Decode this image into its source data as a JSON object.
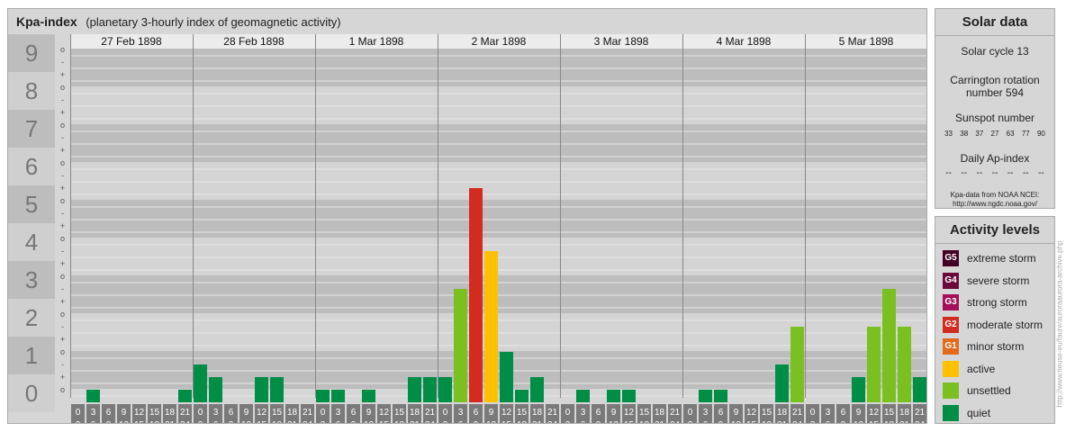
{
  "header": {
    "title": "Kpa-index",
    "subtitle": "(planetary 3-hourly index of geomagnetic activity)"
  },
  "chart_data": {
    "type": "bar",
    "title": "Kpa-index",
    "subtitle": "(planetary 3-hourly index of geomagnetic activity)",
    "y_labels": [
      "9",
      "8",
      "7",
      "6",
      "5",
      "4",
      "3",
      "2",
      "1",
      "0"
    ],
    "minor_labels": [
      "o",
      "-",
      "+",
      "o",
      "-",
      "+",
      "o",
      "-",
      "+",
      "o",
      "-",
      "+",
      "o",
      "-",
      "+",
      "o",
      "-",
      "+",
      "o",
      "-",
      "+",
      "o",
      "-",
      "+",
      "o",
      "-",
      "+",
      "o"
    ],
    "ylim": [
      0,
      9
    ],
    "days": [
      "27 Feb 1898",
      "28 Feb 1898",
      "1 Mar 1898",
      "2 Mar 1898",
      "3 Mar 1898",
      "4 Mar 1898",
      "5 Mar 1898"
    ],
    "interval_start": [
      "0",
      "3",
      "6",
      "9",
      "12",
      "15",
      "18",
      "21"
    ],
    "interval_end": [
      "3",
      "6",
      "9",
      "12",
      "15",
      "18",
      "21",
      "24"
    ],
    "values": [
      [
        0.0,
        0.333,
        0.0,
        0.0,
        0.0,
        0.0,
        0.0,
        0.333
      ],
      [
        1.0,
        0.667,
        0.0,
        0.0,
        0.667,
        0.667,
        0.0,
        0.0
      ],
      [
        0.333,
        0.333,
        0.0,
        0.333,
        0.0,
        0.0,
        0.667,
        0.667
      ],
      [
        0.667,
        3.0,
        5.667,
        4.0,
        1.333,
        0.333,
        0.667,
        0.0
      ],
      [
        0.0,
        0.333,
        0.0,
        0.333,
        0.333,
        0.0,
        0.0,
        0.0
      ],
      [
        0.0,
        0.333,
        0.333,
        0.0,
        0.0,
        0.0,
        1.0,
        2.0
      ],
      [
        0.0,
        0.0,
        0.0,
        0.667,
        2.0,
        3.0,
        2.0,
        0.667
      ]
    ],
    "level_colors": {
      "quiet": "#008d46",
      "unsettled": "#7ac021",
      "active": "#ffc000",
      "minor_storm": "#e26a1c",
      "moderate_storm": "#d42b20",
      "strong_storm": "#a30f59",
      "severe_storm": "#6a0a3c",
      "extreme_storm": "#420024"
    }
  },
  "solar": {
    "title": "Solar data",
    "cycle": "Solar cycle 13",
    "carrington_line1": "Carrington rotation",
    "carrington_line2": "number 594",
    "sunspot_title": "Sunspot number",
    "sunspots": [
      "33",
      "38",
      "37",
      "27",
      "63",
      "77",
      "90"
    ],
    "ap_title": "Daily Ap-index",
    "ap_values": [
      "--",
      "--",
      "--",
      "--",
      "--",
      "--",
      "--"
    ],
    "source_line1": "Kpa-data from NOAA NCEI:",
    "source_line2": "http://www.ngdc.noaa.gov/"
  },
  "legend": {
    "title": "Activity levels",
    "items": [
      {
        "code": "G5",
        "label": "extreme storm",
        "color": "#420024"
      },
      {
        "code": "G4",
        "label": "severe storm",
        "color": "#6a0a3c"
      },
      {
        "code": "G3",
        "label": "strong storm",
        "color": "#a30f59"
      },
      {
        "code": "G2",
        "label": "moderate storm",
        "color": "#d42b20"
      },
      {
        "code": "G1",
        "label": "minor storm",
        "color": "#e26a1c"
      },
      {
        "code": "",
        "label": "active",
        "color": "#ffc000"
      },
      {
        "code": "",
        "label": "unsettled",
        "color": "#7ac021"
      },
      {
        "code": "",
        "label": "quiet",
        "color": "#008d46"
      }
    ]
  },
  "watermark": "http://www.tieuse-eu/faure/auroraaurora-archive.php"
}
